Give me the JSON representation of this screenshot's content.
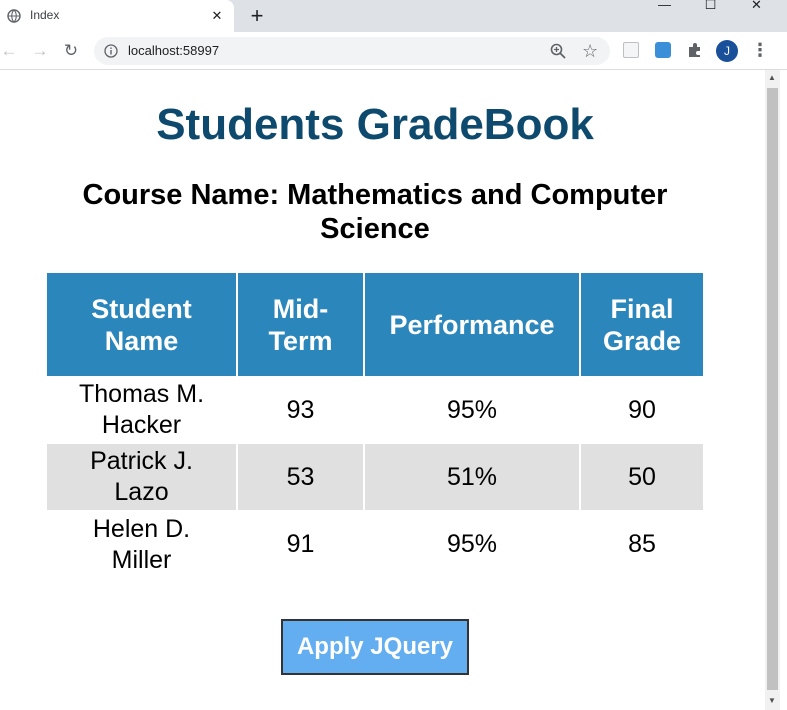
{
  "browser": {
    "tab_title": "Index",
    "tab_close": "✕",
    "new_tab": "+",
    "url": "localhost:58997",
    "window_min": "—",
    "window_max": "☐",
    "window_close": "✕",
    "avatar_letter": "J",
    "menu": "⋮"
  },
  "page": {
    "title": "Students GradeBook",
    "course_heading": "Course Name: Mathematics and Computer Science",
    "apply_button": "Apply JQuery"
  },
  "table": {
    "headers": [
      "Student Name",
      "Mid-Term",
      "Performance",
      "Final Grade"
    ],
    "rows": [
      [
        "Thomas M. Hacker",
        "93",
        "95%",
        "90"
      ],
      [
        "Patrick J. Lazo",
        "53",
        "51%",
        "50"
      ],
      [
        "Helen D. Miller",
        "91",
        "95%",
        "85"
      ]
    ]
  },
  "colors": {
    "title": "#0e4a6e",
    "header_bg": "#2b86bb",
    "alt_row_bg": "#e0e0e0",
    "button_bg": "#63aef0"
  },
  "icons": {
    "favicon": "globe-icon",
    "back": "arrow-left-icon",
    "forward": "arrow-right-icon",
    "reload": "reload-icon",
    "info": "info-icon",
    "zoom": "zoom-icon",
    "star": "star-icon",
    "extensions": "puzzle-icon"
  }
}
